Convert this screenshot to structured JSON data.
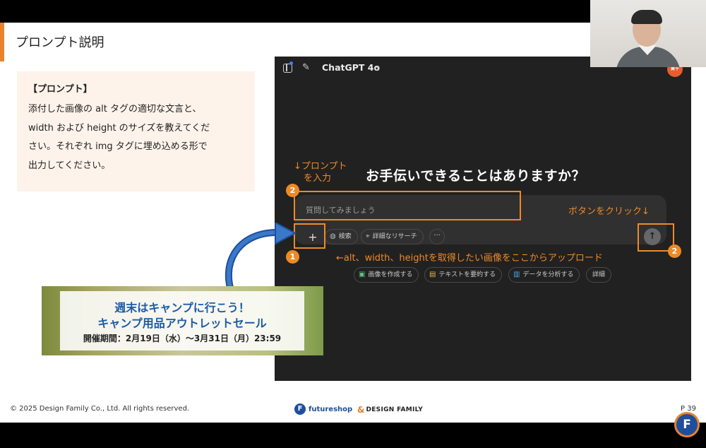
{
  "slide": {
    "title": "プロンプト説明",
    "prompt_heading": "【プロンプト】",
    "prompt_lines": [
      "添付した画像の alt タグの適切な文言と、",
      "width および height のサイズを教えてくだ",
      "さい。それぞれ img タグに埋め込める形で",
      "出力してください。"
    ]
  },
  "chatgpt": {
    "model_name": "ChatGPT 4o",
    "avatar_text": "黄十",
    "headline": "お手伝いできることはありますか？",
    "input_placeholder": "質問してみましょう",
    "plus_label": "+",
    "search_label": "検索",
    "research_label": "詳細なリサーチ",
    "more_label": "···",
    "send_icon": "↑",
    "suggestions": [
      {
        "label": "画像を作成する",
        "icon": "image-icon"
      },
      {
        "label": "テキストを要約する",
        "icon": "document-icon"
      },
      {
        "label": "データを分析する",
        "icon": "bar-chart-icon"
      },
      {
        "label": "詳細",
        "icon": ""
      }
    ]
  },
  "annotations": {
    "prompt_line1": "↓プロンプト",
    "prompt_line2": "を入力",
    "send_note": "ボタンをクリック↓",
    "upload_note": "←alt、width、heightを取得したい画像をここからアップロード",
    "badge_prompt": "2",
    "badge_plus": "1",
    "badge_send": "2",
    "accent_color": "#ee8a26"
  },
  "banner": {
    "line1": "週末はキャンプに行こう！",
    "line2": "キャンプ用品アウトレットセール",
    "line3": "開催期間：2月19日（水）〜3月31日（月）23:59"
  },
  "footer": {
    "copyright": "© 2025 Design Family Co., Ltd. All rights reserved.",
    "futureshop": "futureshop",
    "designfamily": "DESIGN FAMILY",
    "page": "P 39"
  }
}
